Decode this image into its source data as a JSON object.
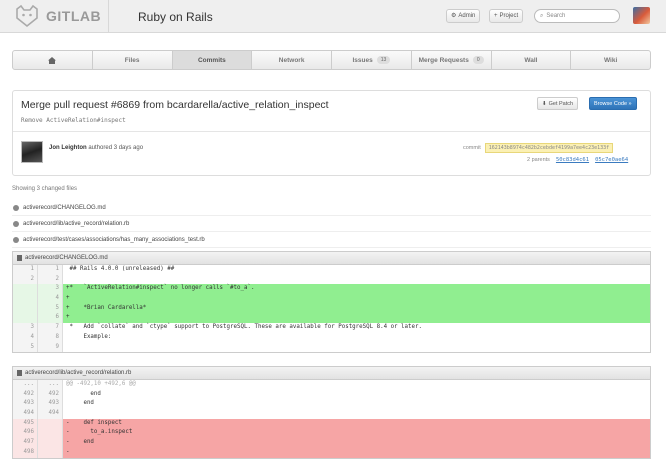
{
  "header": {
    "brand": "GITLAB",
    "project_title": "Ruby on Rails",
    "admin_label": "Admin",
    "project_label": "Project",
    "search_placeholder": "Search"
  },
  "nav": [
    {
      "label": "",
      "icon": "home-icon",
      "active": false
    },
    {
      "label": "Files",
      "active": false
    },
    {
      "label": "Commits",
      "active": true
    },
    {
      "label": "Network",
      "active": false
    },
    {
      "label": "Issues",
      "count": "13",
      "active": false
    },
    {
      "label": "Merge Requests",
      "count": "0",
      "active": false
    },
    {
      "label": "Wall",
      "active": false
    },
    {
      "label": "Wiki",
      "active": false
    }
  ],
  "commit": {
    "title": "Merge pull request #6869 from bcardarella/active_relation_inspect",
    "description": "Remove ActiveRelation#inspect",
    "patch_label": "Get Patch",
    "browse_label": "Browse Code »",
    "author": "Jon Leighton",
    "authored_text": "authored 3 days ago",
    "commit_label": "commit",
    "sha": "162143b8974c482b2cebdef4199a7ee4c23e133f",
    "parents_label": "2 parents",
    "parent1": "50c83d4c61",
    "parent2": "05c7e0ae64"
  },
  "changed": {
    "title": "Showing 3 changed files",
    "files": [
      "activerecord/CHANGELOG.md",
      "activerecord/lib/active_record/relation.rb",
      "activerecord/test/cases/associations/has_many_associations_test.rb"
    ]
  },
  "diff1": {
    "filename": "activerecord/CHANGELOG.md",
    "lines": [
      {
        "old": "1",
        "new": "1",
        "type": "ctx",
        "text": " ## Rails 4.0.0 (unreleased) ##"
      },
      {
        "old": "2",
        "new": "2",
        "type": "ctx",
        "text": ""
      },
      {
        "old": "",
        "new": "3",
        "type": "add",
        "text": "+*   `ActiveRelation#inspect` no longer calls `#to_a`."
      },
      {
        "old": "",
        "new": "4",
        "type": "add",
        "text": "+"
      },
      {
        "old": "",
        "new": "5",
        "type": "add",
        "text": "+    *Brian Cardarella*"
      },
      {
        "old": "",
        "new": "6",
        "type": "add",
        "text": "+"
      },
      {
        "old": "3",
        "new": "7",
        "type": "ctx",
        "text": " *   Add `collate` and `ctype` support to PostgreSQL. These are available for PostgreSQL 8.4 or later."
      },
      {
        "old": "4",
        "new": "8",
        "type": "ctx",
        "text": "     Example:"
      },
      {
        "old": "5",
        "new": "9",
        "type": "ctx",
        "text": ""
      }
    ]
  },
  "diff2": {
    "filename": "activerecord/lib/active_record/relation.rb",
    "lines": [
      {
        "old": "...",
        "new": "...",
        "type": "meta",
        "text": "@@ -492,10 +492,6 @@"
      },
      {
        "old": "492",
        "new": "492",
        "type": "ctx",
        "text": "       end"
      },
      {
        "old": "493",
        "new": "493",
        "type": "ctx",
        "text": "     end"
      },
      {
        "old": "494",
        "new": "494",
        "type": "ctx",
        "text": ""
      },
      {
        "old": "495",
        "new": "",
        "type": "del",
        "text": "-    def inspect"
      },
      {
        "old": "496",
        "new": "",
        "type": "del",
        "text": "-      to_a.inspect"
      },
      {
        "old": "497",
        "new": "",
        "type": "del",
        "text": "-    end"
      },
      {
        "old": "498",
        "new": "",
        "type": "del",
        "text": "-"
      }
    ]
  }
}
